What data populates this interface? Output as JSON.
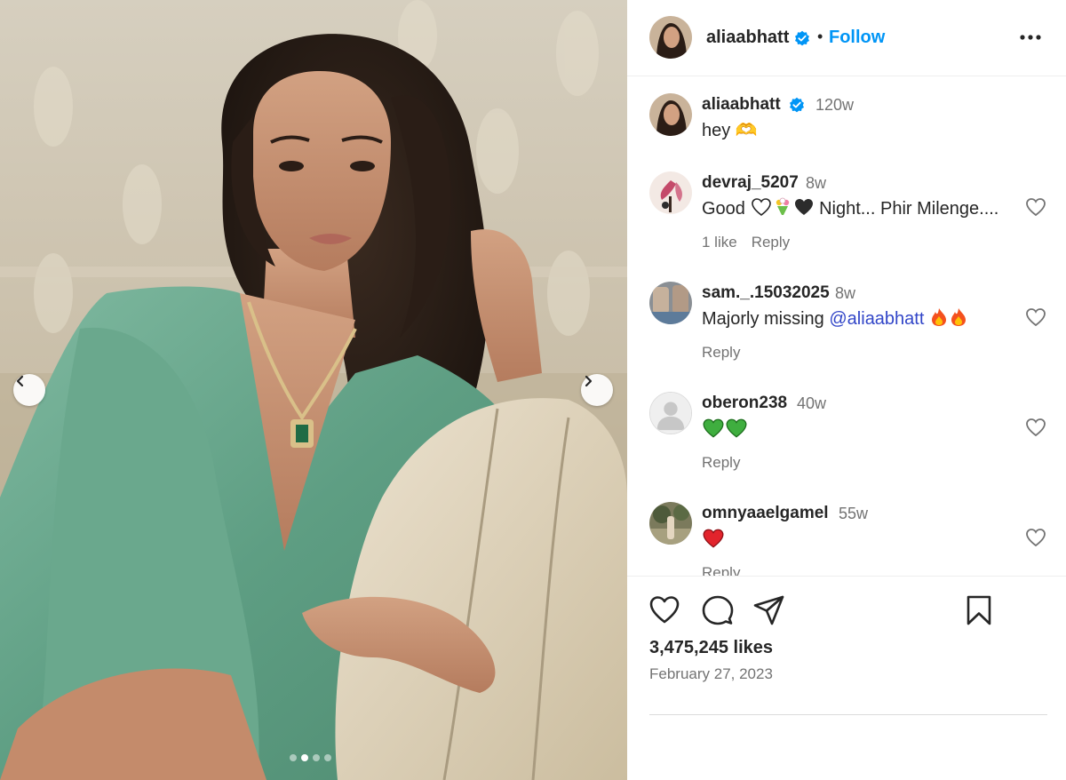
{
  "post": {
    "username": "aliaabhatt",
    "follow_label": "Follow",
    "separator": "•",
    "more_icon": "more-horizontal-icon"
  },
  "caption": {
    "username": "aliaabhatt",
    "time": "120w",
    "text": "hey 🫶"
  },
  "comments": [
    {
      "username": "devraj_5207",
      "time": "8w",
      "text_prefix": "Good",
      "text_suffix": "Night... Phir Milenge....",
      "likes": "1 like",
      "reply": "Reply"
    },
    {
      "username": "sam._.15032025",
      "time": "8w",
      "text_prefix": "Majorly missing",
      "mention": "@aliaabhatt",
      "reply": "Reply"
    },
    {
      "username": "oberon238",
      "time": "40w",
      "reply": "Reply"
    },
    {
      "username": "omnyaaelgamel",
      "time": "55w",
      "reply": "Reply"
    }
  ],
  "stats": {
    "likes": "3,475,245 likes",
    "date": "February 27, 2023"
  },
  "carousel": {
    "slide_count": 4,
    "active_index": 1
  },
  "colors": {
    "follow": "#0095f6",
    "verified": "#0095f6",
    "mention": "#3246c8",
    "muted": "#737373"
  }
}
